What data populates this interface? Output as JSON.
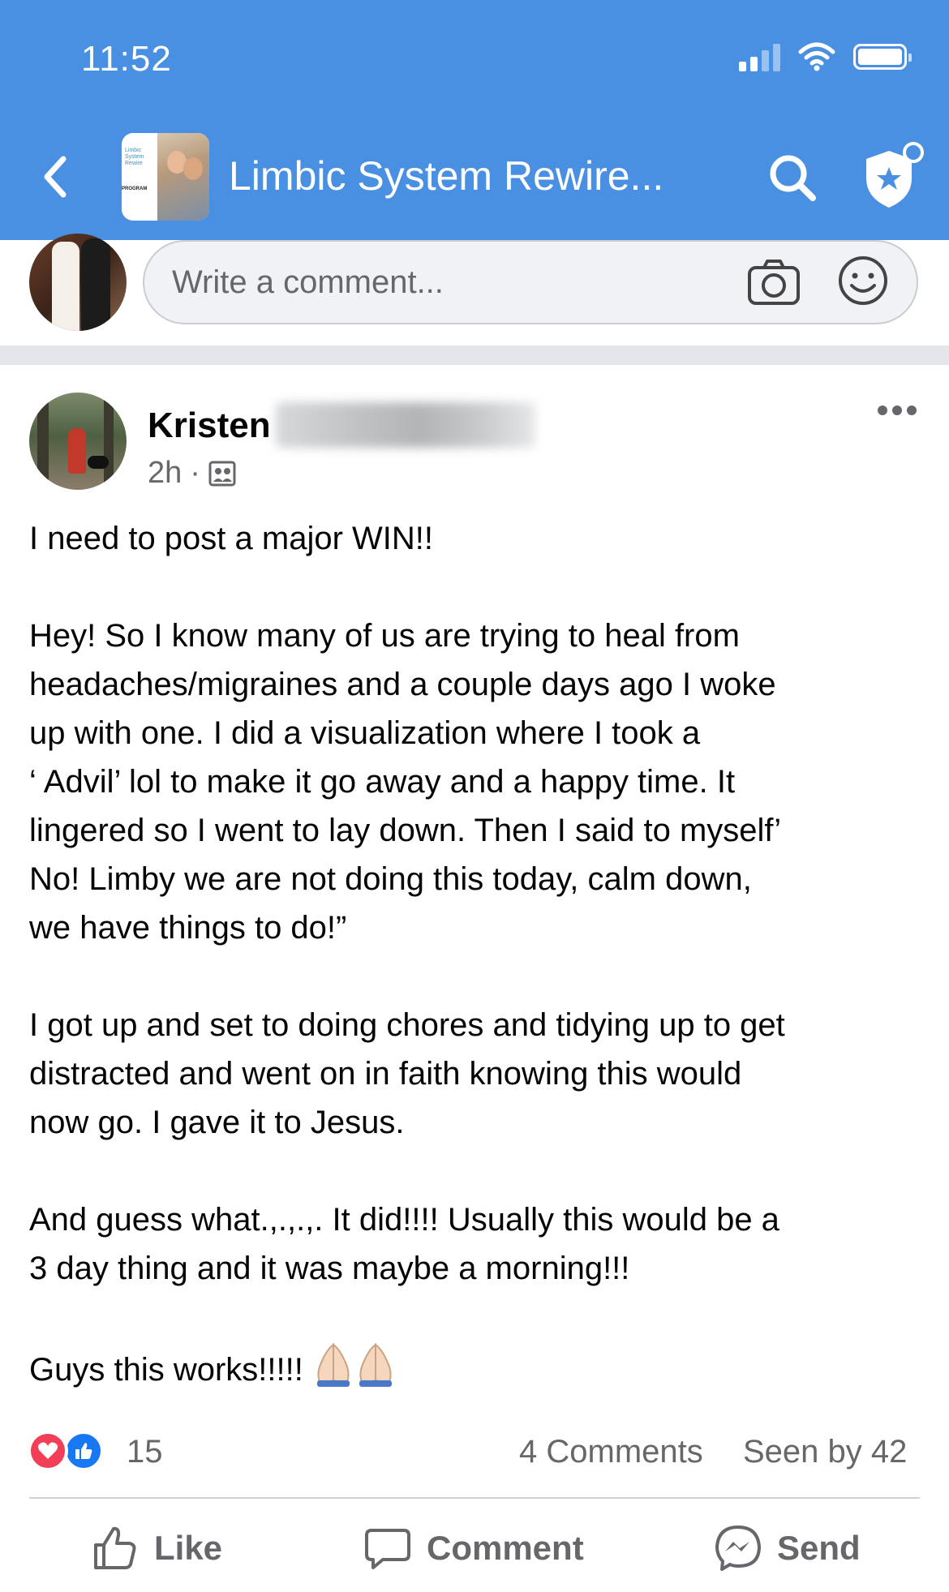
{
  "status_bar": {
    "time": "11:52"
  },
  "header": {
    "group_title": "Limbic System Rewire...",
    "thumb_text": "Limbic System Rewire",
    "thumb_program": "PROGRAM"
  },
  "comment_box": {
    "placeholder": "Write a comment..."
  },
  "post": {
    "author_first_name": "Kristen",
    "time_ago": "2h",
    "paragraphs": [
      [
        "I need to post a major WIN!!"
      ],
      [
        "Hey! So I know many of us are trying to heal from",
        "headaches/migraines and a couple days ago I woke",
        "up with one. I did a visualization where I took a",
        "‘ Advil’ lol to make it go away and a happy time. It",
        "lingered so I went to lay down. Then I said to myself’",
        "No! Limby we are not doing this today, calm down,",
        "we have things to do!”"
      ],
      [
        "I got up and set to doing chores and tidying up to get",
        "distracted and went on in faith knowing this would",
        "now go. I gave it to Jesus."
      ],
      [
        "And guess what.,.,.,. It did!!!! Usually this would be a",
        "3 day thing and it was maybe a morning!!!"
      ]
    ],
    "closing": "Guys this works!!!!! ",
    "reaction_count": "15",
    "comments_count": "4 Comments",
    "seen_by": "Seen by 42"
  },
  "actions": {
    "like": "Like",
    "comment": "Comment",
    "send": "Send"
  },
  "colors": {
    "header_bg": "#4a90e2",
    "like_blue": "#1877f2",
    "love_red": "#f33e58",
    "muted_text": "#65676b"
  }
}
